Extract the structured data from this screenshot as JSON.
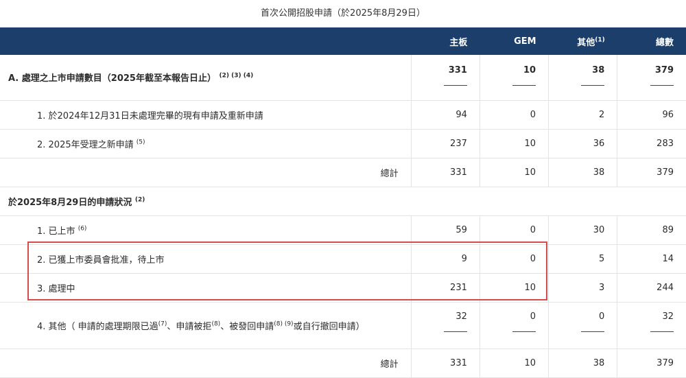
{
  "caption": "首次公開招股申請（於2025年8月29日）",
  "header": {
    "main": "主板",
    "gem": "GEM",
    "other": "其他",
    "other_note": "(1)",
    "total": "總數"
  },
  "section_a": {
    "label": "A. 處理之上市申請數目（",
    "label_bold": "2025",
    "label_rest": "年截至本報告日止）",
    "notes": "(2) (3) (4)",
    "values": [
      "331",
      "10",
      "38",
      "379"
    ]
  },
  "a_rows": [
    {
      "label": "1. 於2024年12月31日未處理完畢的現有申請及重新申請",
      "note": "",
      "values": [
        "94",
        "0",
        "2",
        "96"
      ]
    },
    {
      "label": "2. 2025年受理之新申請",
      "note": "(5)",
      "values": [
        "237",
        "10",
        "36",
        "283"
      ]
    }
  ],
  "a_total": {
    "label": "總計",
    "values": [
      "331",
      "10",
      "38",
      "379"
    ]
  },
  "section_b": {
    "label": "於2025年8月29日的申請狀況",
    "note": "(2)"
  },
  "b_rows": [
    {
      "label": "1. 已上市",
      "note": "(6)",
      "values": [
        "59",
        "0",
        "30",
        "89"
      ]
    },
    {
      "label": "2. 已獲上市委員會批准，待上市",
      "note": "",
      "values": [
        "9",
        "0",
        "5",
        "14"
      ]
    },
    {
      "label": "3. 處理中",
      "note": "",
      "values": [
        "231",
        "10",
        "3",
        "244"
      ]
    }
  ],
  "b_row4": {
    "p1": "4. 其他（ 申請的處理期限已過",
    "n1": "(7)",
    "p2": "、申請被拒",
    "n2": "(8)",
    "p3": "、被發回申請",
    "n3": "(8) (9)",
    "p4": "或自行撤回申請）",
    "values": [
      "32",
      "0",
      "0",
      "32"
    ]
  },
  "b_total": {
    "label": "總計",
    "values": [
      "331",
      "10",
      "38",
      "379"
    ]
  },
  "highlight_color": "#d94a4a",
  "header_color": "#1b3f6a"
}
